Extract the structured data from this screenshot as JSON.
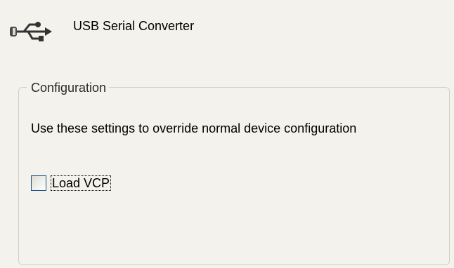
{
  "header": {
    "icon": "usb-icon",
    "device_name": "USB Serial Converter"
  },
  "configuration": {
    "legend": "Configuration",
    "description": "Use these settings to override normal device configuration",
    "load_vcp": {
      "label": "Load VCP",
      "checked": false
    }
  },
  "colors": {
    "background": "#f3f2ec",
    "groupbox_border": "#d0d0bf",
    "checkbox_border": "#1c5180"
  }
}
